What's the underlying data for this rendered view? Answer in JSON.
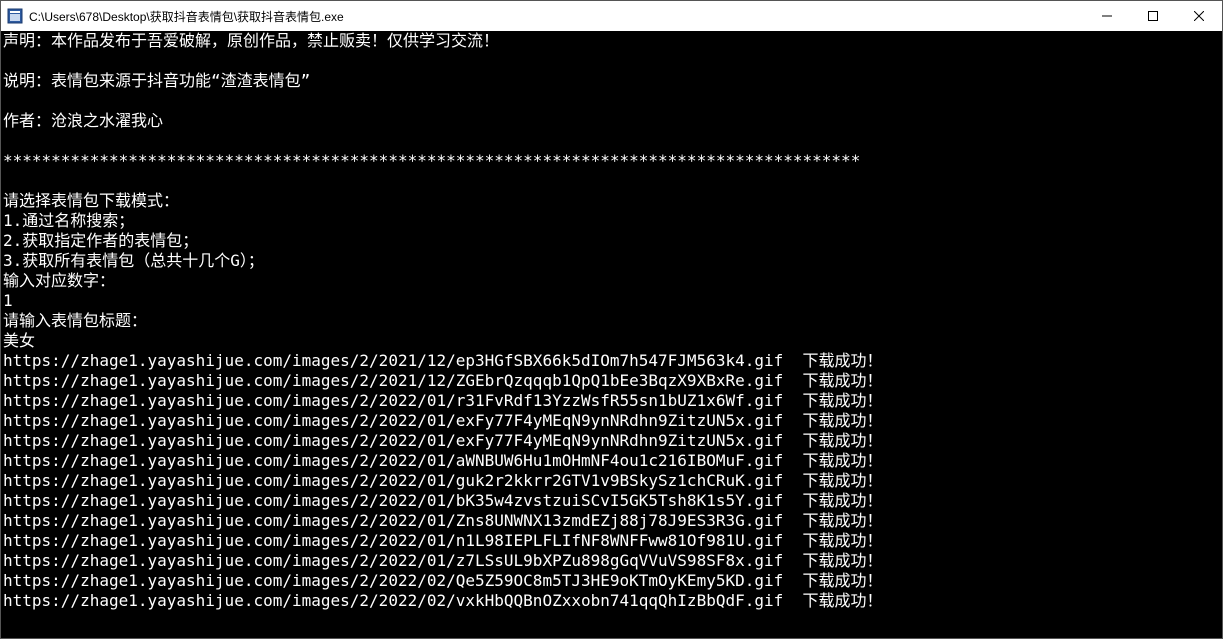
{
  "titlebar": {
    "path": "C:\\Users\\678\\Desktop\\获取抖音表情包\\获取抖音表情包.exe"
  },
  "console": {
    "header": [
      "声明：本作品发布于吾爱破解，原创作品，禁止贩卖！仅供学习交流！",
      "",
      "说明：表情包来源于抖音功能“渣渣表情包”",
      "",
      "作者：沧浪之水濯我心",
      "",
      "*****************************************************************************************",
      "",
      "请选择表情包下载模式：",
      "1.通过名称搜索；",
      "2.获取指定作者的表情包；",
      "3.获取所有表情包（总共十几个G）；",
      "输入对应数字：",
      "1",
      "请输入表情包标题：",
      "美女"
    ],
    "downloads": [
      {
        "url": "https://zhage1.yayashijue.com/images/2/2021/12/ep3HGfSBX66k5dIOm7h547FJM563k4.gif",
        "status": "下载成功！"
      },
      {
        "url": "https://zhage1.yayashijue.com/images/2/2021/12/ZGEbrQzqqqb1QpQ1bEe3BqzX9XBxRe.gif",
        "status": "下载成功！"
      },
      {
        "url": "https://zhage1.yayashijue.com/images/2/2022/01/r31FvRdf13YzzWsfR55sn1bUZ1x6Wf.gif",
        "status": "下载成功！"
      },
      {
        "url": "https://zhage1.yayashijue.com/images/2/2022/01/exFy77F4yMEqN9ynNRdhn9ZitzUN5x.gif",
        "status": "下载成功！"
      },
      {
        "url": "https://zhage1.yayashijue.com/images/2/2022/01/exFy77F4yMEqN9ynNRdhn9ZitzUN5x.gif",
        "status": "下载成功！"
      },
      {
        "url": "https://zhage1.yayashijue.com/images/2/2022/01/aWNBUW6Hu1mOHmNF4ou1c216IBOMuF.gif",
        "status": "下载成功！"
      },
      {
        "url": "https://zhage1.yayashijue.com/images/2/2022/01/guk2r2kkrr2GTV1v9BSkySz1chCRuK.gif",
        "status": "下载成功！"
      },
      {
        "url": "https://zhage1.yayashijue.com/images/2/2022/01/bK35w4zvstzuiSCvI5GK5Tsh8K1s5Y.gif",
        "status": "下载成功！"
      },
      {
        "url": "https://zhage1.yayashijue.com/images/2/2022/01/Zns8UNWNX13zmdEZj88j78J9ES3R3G.gif",
        "status": "下载成功！"
      },
      {
        "url": "https://zhage1.yayashijue.com/images/2/2022/01/n1L98IEPLFLIfNF8WNFFww81Of981U.gif",
        "status": "下载成功！"
      },
      {
        "url": "https://zhage1.yayashijue.com/images/2/2022/01/z7LSsUL9bXPZu898gGqVVuVS98SF8x.gif",
        "status": "下载成功！"
      },
      {
        "url": "https://zhage1.yayashijue.com/images/2/2022/02/Qe5Z59OC8m5TJ3HE9oKTmOyKEmy5KD.gif",
        "status": "下载成功！"
      },
      {
        "url": "https://zhage1.yayashijue.com/images/2/2022/02/vxkHbQQBnOZxxobn741qqQhIzBbQdF.gif",
        "status": "下载成功！"
      }
    ]
  }
}
